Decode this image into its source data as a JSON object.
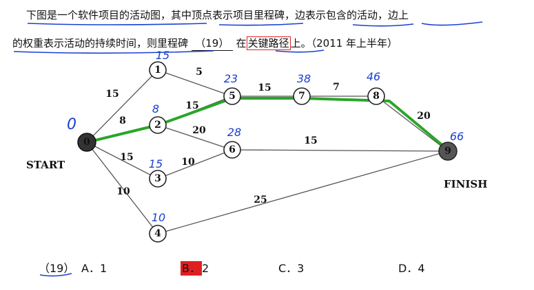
{
  "question": {
    "line1": "下图是一个软件项目的活动图，其中顶点表示项目里程碑，边表示包含的活动，边上",
    "line2_a": "的权重表示活动的持续时间，则里程碑",
    "blank": "（19）",
    "line2_b": "在",
    "line2_boxed": "关键路径",
    "line2_c": "上。（2011 年上半年）"
  },
  "graph": {
    "start_label": "START",
    "finish_label": "FINISH",
    "nodes": [
      "0",
      "1",
      "2",
      "3",
      "4",
      "5",
      "6",
      "7",
      "8",
      "9"
    ],
    "edge_weights": {
      "e01": "15",
      "e02": "8",
      "e03": "15",
      "e04": "10",
      "e15": "5",
      "e25": "15",
      "e26": "20",
      "e36": "10",
      "e57": "15",
      "e78": "7",
      "e89": "20",
      "e69": "15",
      "e49": "25"
    },
    "handwritten": {
      "n0": "0",
      "n1": "15",
      "n2": "8",
      "n3": "15",
      "n4": "10",
      "n5": "23",
      "n6": "28",
      "n7": "38",
      "n8": "46",
      "n9": "66"
    },
    "highlight_color": "#2aa52a",
    "underline_color": "#1a3fd1"
  },
  "options": {
    "number": "（19）",
    "a": "A．1",
    "b_letter": "B．",
    "b_value": "2",
    "c": "C．3",
    "d": "D．4",
    "selected_color": "#e02020"
  }
}
